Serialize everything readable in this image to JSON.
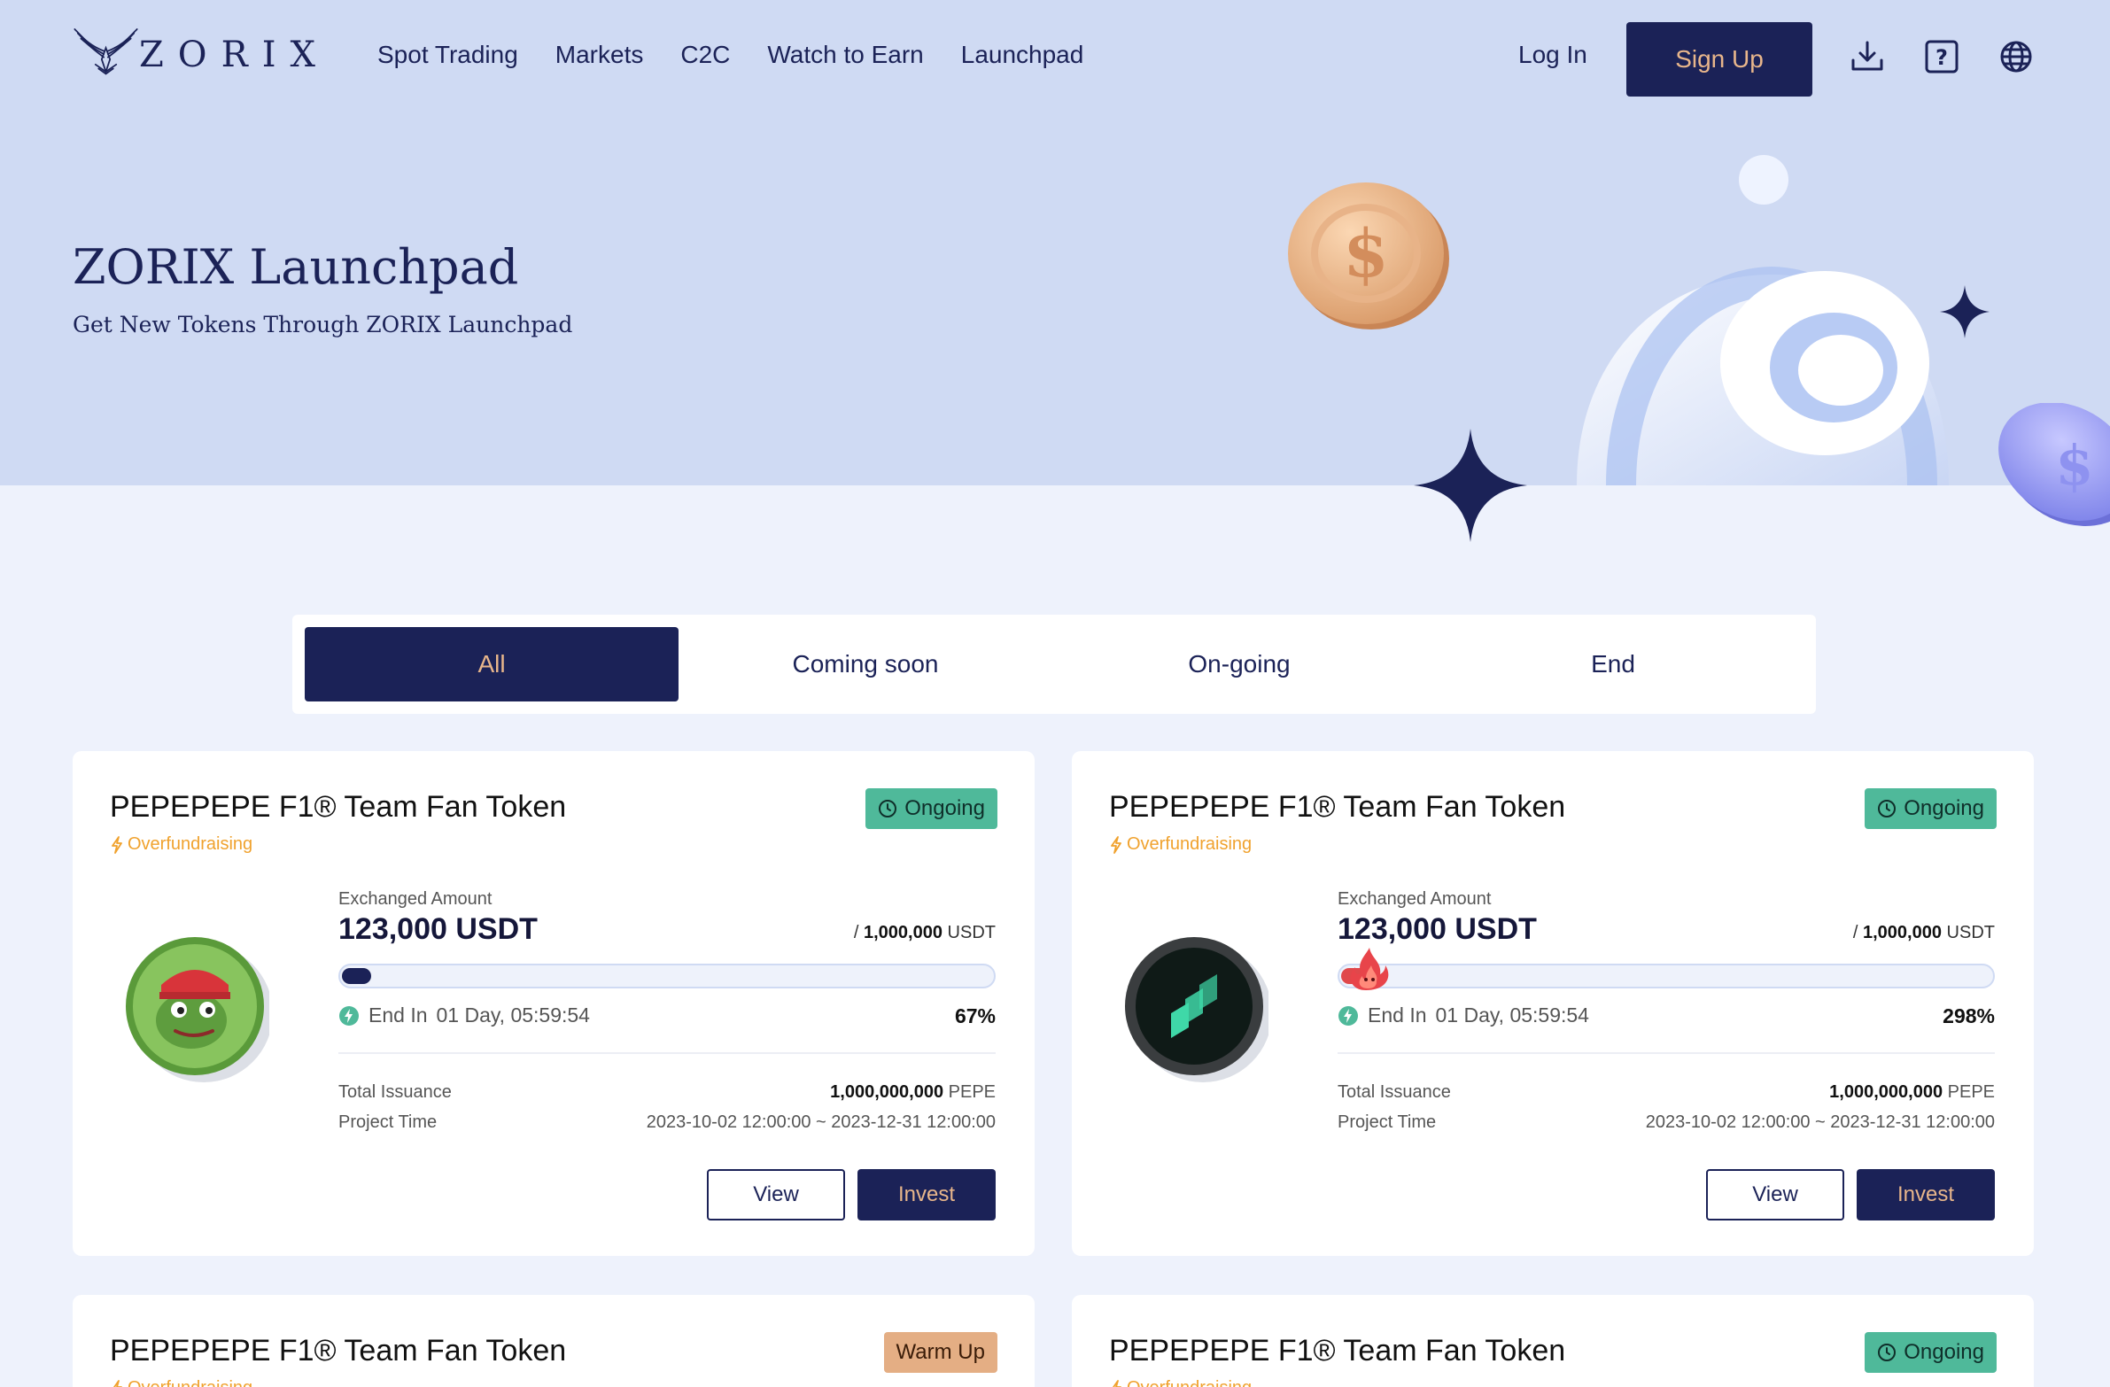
{
  "nav": {
    "brand": "ZORIX",
    "links": [
      "Spot Trading",
      "Markets",
      "C2C",
      "Watch to Earn",
      "Launchpad"
    ],
    "login": "Log In",
    "signup": "Sign Up"
  },
  "hero": {
    "title": "ZORIX Launchpad",
    "subtitle": "Get New Tokens Through ZORIX Launchpad"
  },
  "tabs": [
    "All",
    "Coming soon",
    "On-going",
    "End"
  ],
  "active_tab": "All",
  "colors": {
    "navy": "#1b2257",
    "gold": "#e8b68b",
    "ongoing": "#4fb99a",
    "warmup": "#e4ae84",
    "overfund": "#f0a22e"
  },
  "cards": [
    {
      "title": "PEPEPEPE F1® Team Fan Token",
      "tag": "Overfundraising",
      "status": "Ongoing",
      "coin_icon": "pepe-coin-icon",
      "exchanged_label": "Exchanged Amount",
      "exchanged": "123,000 USDT",
      "target_prefix": "/",
      "target": "1,000,000",
      "target_unit": "USDT",
      "progress_fraction": 0.045,
      "end_label": "End In",
      "countdown": "01 Day, 05:59:54",
      "percent": "67%",
      "issuance_label": "Total Issuance",
      "issuance": "1,000,000,000",
      "issuance_unit": "PEPE",
      "time_label": "Project Time",
      "time": "2023-10-02 12:00:00 ~ 2023-12-31 12:00:00",
      "view": "View",
      "invest": "Invest"
    },
    {
      "title": "PEPEPEPE F1® Team Fan Token",
      "tag": "Overfundraising",
      "status": "Ongoing",
      "coin_icon": "compound-coin-icon",
      "exchanged_label": "Exchanged Amount",
      "exchanged": "123,000 USDT",
      "target_prefix": "/",
      "target": "1,000,000",
      "target_unit": "USDT",
      "progress_fraction": 0.06,
      "end_label": "End In",
      "countdown": "01 Day, 05:59:54",
      "percent": "298%",
      "issuance_label": "Total Issuance",
      "issuance": "1,000,000,000",
      "issuance_unit": "PEPE",
      "time_label": "Project Time",
      "time": "2023-10-02 12:00:00 ~ 2023-12-31 12:00:00",
      "view": "View",
      "invest": "Invest"
    },
    {
      "title": "PEPEPEPE F1® Team Fan Token",
      "tag": "Overfundraising",
      "status": "Warm Up"
    },
    {
      "title": "PEPEPEPE F1® Team Fan Token",
      "tag": "Overfundraising",
      "status": "Ongoing"
    }
  ]
}
